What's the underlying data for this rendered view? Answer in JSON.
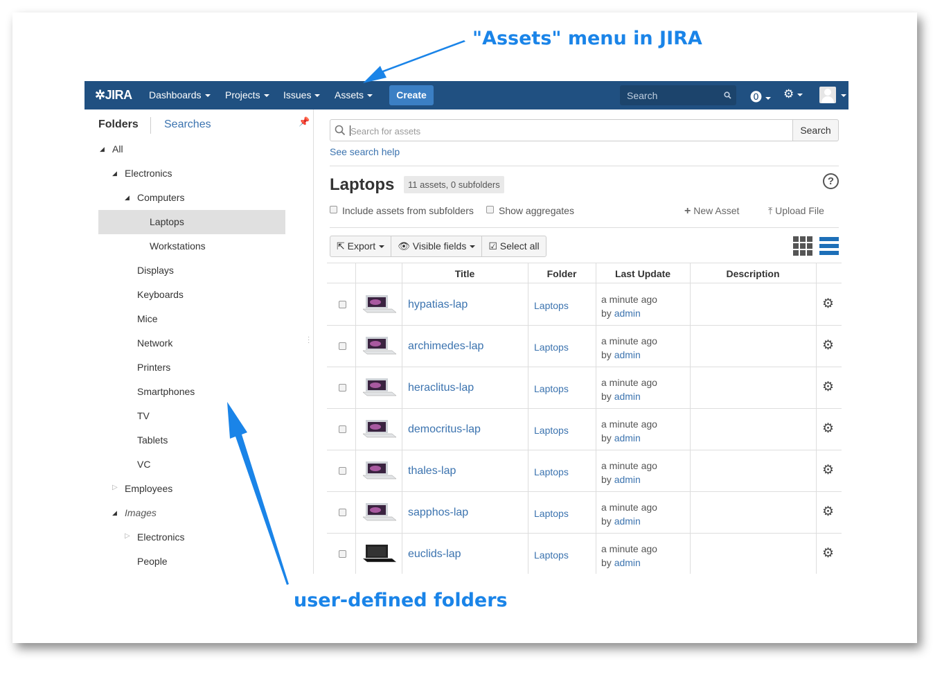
{
  "callouts": {
    "top": "\"Assets\" menu in JIRA",
    "bottom": "user-defined folders"
  },
  "nav": {
    "logo": "JIRA",
    "items": [
      "Dashboards",
      "Projects",
      "Issues",
      "Assets"
    ],
    "create": "Create",
    "search_placeholder": "Search",
    "help_icon": "help-icon",
    "settings_icon": "gear-icon",
    "colors": {
      "bar": "#205081",
      "create": "#3b7fc4"
    }
  },
  "sidebar": {
    "tabs": {
      "active": "Folders",
      "inactive": "Searches"
    },
    "tree": [
      {
        "label": "All"
      },
      {
        "label": "Electronics"
      },
      {
        "label": "Computers"
      },
      {
        "label": "Laptops"
      },
      {
        "label": "Workstations"
      },
      {
        "label": "Displays"
      },
      {
        "label": "Keyboards"
      },
      {
        "label": "Mice"
      },
      {
        "label": "Network"
      },
      {
        "label": "Printers"
      },
      {
        "label": "Smartphones"
      },
      {
        "label": "TV"
      },
      {
        "label": "Tablets"
      },
      {
        "label": "VC"
      },
      {
        "label": "Employees"
      },
      {
        "label": "Images"
      },
      {
        "label": "Electronics"
      },
      {
        "label": "People"
      }
    ],
    "selected": "Laptops"
  },
  "main": {
    "search_placeholder": "Search for assets",
    "search_button": "Search",
    "search_help": "See search help",
    "title": "Laptops",
    "count": "11 assets, 0 subfolders",
    "include_subfolders": "Include assets from subfolders",
    "show_aggregates": "Show aggregates",
    "new_asset": "New Asset",
    "upload_file": "Upload File",
    "toolbar": {
      "export": "Export",
      "visible_fields": "Visible fields",
      "select_all": "Select all"
    },
    "columns": [
      "Title",
      "Folder",
      "Last Update",
      "Description"
    ],
    "rows": [
      {
        "title": "hypatias-lap",
        "folder": "Laptops",
        "updated": "a minute ago",
        "by_prefix": "by",
        "by": "admin"
      },
      {
        "title": "archimedes-lap",
        "folder": "Laptops",
        "updated": "a minute ago",
        "by_prefix": "by",
        "by": "admin"
      },
      {
        "title": "heraclitus-lap",
        "folder": "Laptops",
        "updated": "a minute ago",
        "by_prefix": "by",
        "by": "admin"
      },
      {
        "title": "democritus-lap",
        "folder": "Laptops",
        "updated": "a minute ago",
        "by_prefix": "by",
        "by": "admin"
      },
      {
        "title": "thales-lap",
        "folder": "Laptops",
        "updated": "a minute ago",
        "by_prefix": "by",
        "by": "admin"
      },
      {
        "title": "sapphos-lap",
        "folder": "Laptops",
        "updated": "a minute ago",
        "by_prefix": "by",
        "by": "admin"
      },
      {
        "title": "euclids-lap",
        "folder": "Laptops",
        "updated": "a minute ago",
        "by_prefix": "by",
        "by": "admin"
      }
    ]
  }
}
